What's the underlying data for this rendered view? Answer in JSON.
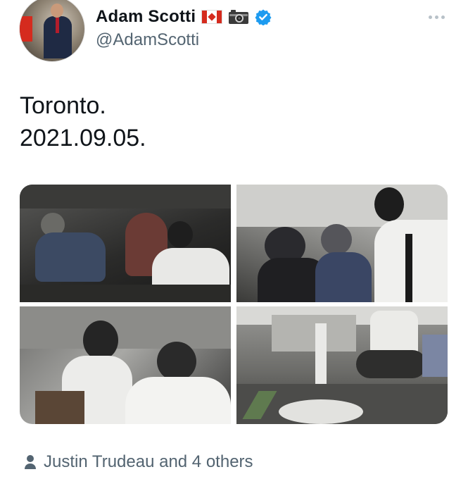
{
  "author": {
    "display_name": "Adam Scotti",
    "handle": "@AdamScotti",
    "name_emojis": [
      "canada-flag-icon",
      "camera-icon"
    ],
    "verified": true,
    "verified_color": "#1d9bf0"
  },
  "tweet": {
    "lines": [
      "Toronto.",
      "2021.09.05."
    ]
  },
  "media": {
    "photo_count": 4
  },
  "liked_by": {
    "text": "Justin Trudeau and 4 others"
  },
  "colors": {
    "text_primary": "#0f1419",
    "text_secondary": "#536471",
    "accent": "#1d9bf0"
  }
}
